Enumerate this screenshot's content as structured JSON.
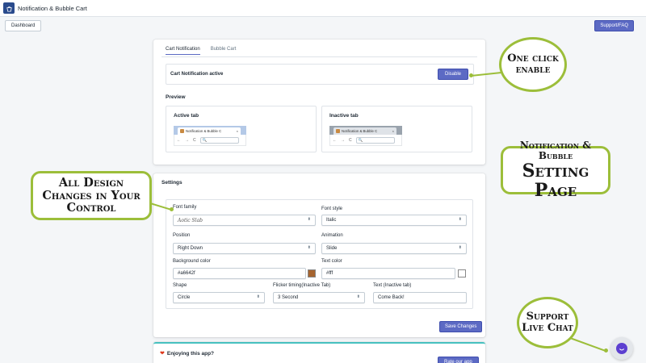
{
  "app": {
    "title": "Notification & Bubble Cart"
  },
  "nav": {
    "dashboard_label": "Dashboard",
    "support_label": "Support/FAQ"
  },
  "tabs": [
    {
      "label": "Cart Notification",
      "active": true
    },
    {
      "label": "Bubble Cart",
      "active": false
    }
  ],
  "notification": {
    "status_text": "Cart Notification active",
    "disable_label": "Disable"
  },
  "preview": {
    "title": "Preview",
    "active_tab_label": "Active tab",
    "inactive_tab_label": "Inactive tab",
    "browser_tab_title": "Notification & Bubble C",
    "tab_close": "×",
    "nav_back": "←",
    "nav_forward": "→",
    "nav_reload": "C",
    "url_icon": "🔍"
  },
  "settings": {
    "title": "Settings",
    "font_family": {
      "label": "Font family",
      "value": "Aotic Slab"
    },
    "font_style": {
      "label": "Font style",
      "value": "Italic"
    },
    "position": {
      "label": "Position",
      "value": "Right Down"
    },
    "animation": {
      "label": "Animation",
      "value": "Slide"
    },
    "background_color": {
      "label": "Background color",
      "value": "#a6642f"
    },
    "text_color": {
      "label": "Text color",
      "value": "#fff"
    },
    "shape": {
      "label": "Shape",
      "value": "Circle"
    },
    "flicker_timing": {
      "label": "Flicker timing(Inactive Tab)",
      "value": "3 Second"
    },
    "text_inactive": {
      "label": "Text (Inactive tab)",
      "value": "Come Back!"
    },
    "save_label": "Save Changes",
    "caret": "⬍"
  },
  "footer_card": {
    "title": "Enjoying this app?",
    "rate_label": "Rate our app"
  },
  "callouts": {
    "one_click": "One click enable",
    "notif_line1": "Notification & Bubble",
    "notif_line2": "Setting Page",
    "design": "All Design Changes in Your Control",
    "support": "Support Live Chat"
  },
  "colors": {
    "accent": "#5c6ac4",
    "callout_border": "#9cbe3a",
    "bg_swatch": "#a6642f",
    "chat": "#5c3fd0"
  }
}
